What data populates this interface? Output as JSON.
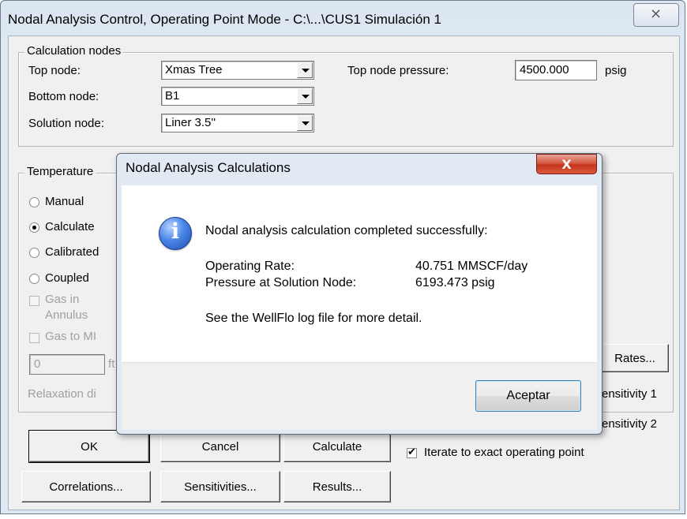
{
  "window": {
    "title": "Nodal Analysis Control, Operating Point Mode - C:\\...\\CUS1 Simulación 1",
    "close_glyph": "⨯"
  },
  "calc_nodes": {
    "legend": "Calculation nodes",
    "top_label": "Top node:",
    "top_value": "Xmas Tree",
    "bottom_label": "Bottom node:",
    "bottom_value": "B1",
    "solution_label": "Solution node:",
    "solution_value": "Liner 3.5''",
    "top_pressure_label": "Top node pressure:",
    "top_pressure_value": "4500.000",
    "top_pressure_unit": "psig"
  },
  "temperature": {
    "legend": "Temperature",
    "options": [
      "Manual",
      "Calculate",
      "Calibrated",
      "Coupled"
    ],
    "selected": "Calculate",
    "gas_in_annulus": [
      "Gas in",
      "Annulus"
    ],
    "gas_to_label": "Gas to MI",
    "field_value": "0",
    "field_unit": "ft",
    "relaxation_label": "Relaxation di"
  },
  "right_panel": {
    "rates_button": "Rates...",
    "sensitivity1": "ensitivity 1",
    "sensitivity2": "ensitivity 2",
    "iterate_label": "Iterate to exact operating point",
    "iterate_checked": true
  },
  "buttons": {
    "ok": "OK",
    "cancel": "Cancel",
    "calculate": "Calculate",
    "correlations": "Correlations...",
    "sensitivities": "Sensitivities...",
    "results": "Results..."
  },
  "dialog": {
    "title": "Nodal Analysis Calculations",
    "close_glyph": "X",
    "icon": "info-icon",
    "heading": "Nodal analysis calculation completed successfully:",
    "rate_label": "Operating Rate:",
    "rate_value": "40.751 MMSCF/day",
    "pressure_label": "Pressure at Solution Node:",
    "pressure_value": "6193.473 psig",
    "footer_text": "See the WellFlo log file for more detail.",
    "accept_label": "Aceptar"
  }
}
